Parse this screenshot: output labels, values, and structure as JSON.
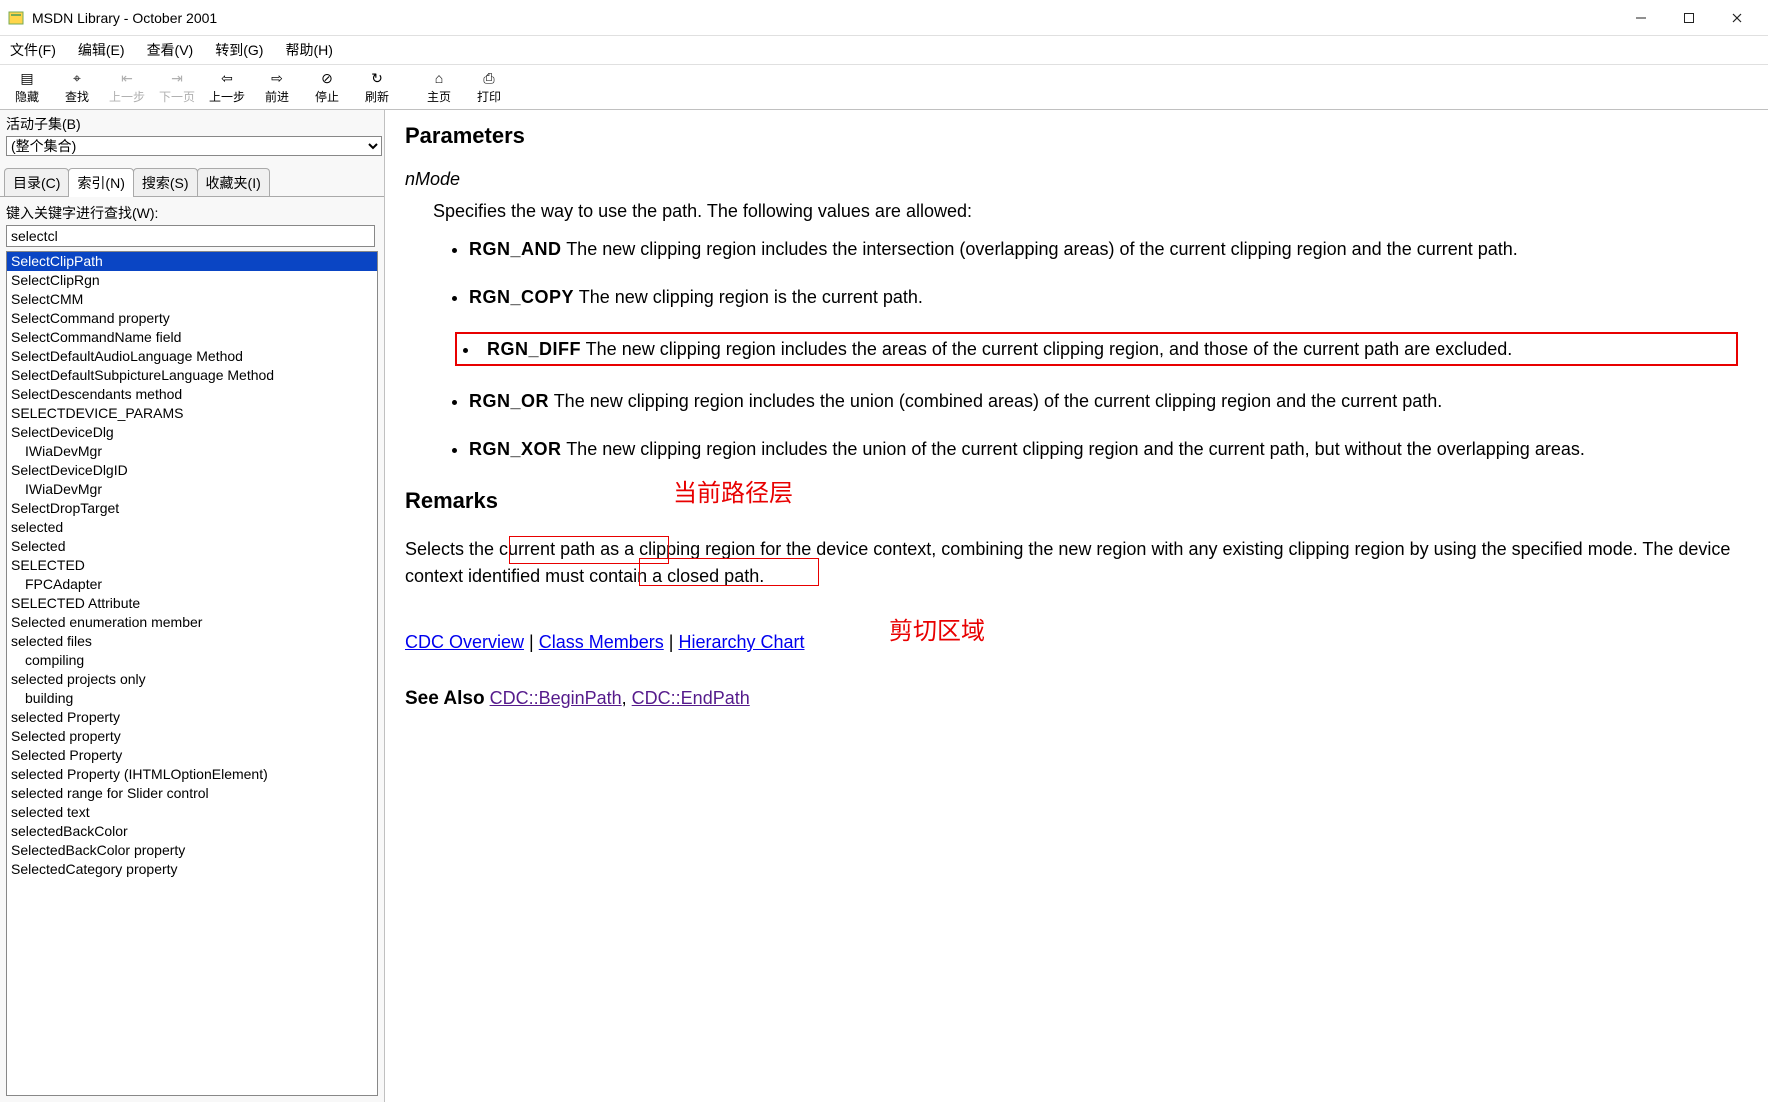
{
  "window": {
    "title": "MSDN Library - October 2001"
  },
  "menus": [
    "文件(F)",
    "编辑(E)",
    "查看(V)",
    "转到(G)",
    "帮助(H)"
  ],
  "toolbar": [
    {
      "icon": "hide-icon",
      "label": "隐藏",
      "enabled": true,
      "glyph": "▤"
    },
    {
      "icon": "locate-icon",
      "label": "查找",
      "enabled": true,
      "glyph": "⌖"
    },
    {
      "icon": "back-step-icon",
      "label": "上一步",
      "enabled": false,
      "glyph": "⇤"
    },
    {
      "icon": "next-page-icon",
      "label": "下一页",
      "enabled": false,
      "glyph": "⇥"
    },
    {
      "icon": "prev-icon",
      "label": "上一步",
      "enabled": true,
      "glyph": "⇦"
    },
    {
      "icon": "forward-icon",
      "label": "前进",
      "enabled": true,
      "glyph": "⇨"
    },
    {
      "icon": "stop-icon",
      "label": "停止",
      "enabled": true,
      "glyph": "⊘"
    },
    {
      "icon": "refresh-icon",
      "label": "刷新",
      "enabled": true,
      "glyph": "↻"
    },
    {
      "icon": "home-icon",
      "label": "主页",
      "enabled": true,
      "glyph": "⌂"
    },
    {
      "icon": "print-icon",
      "label": "打印",
      "enabled": true,
      "glyph": "⎙"
    }
  ],
  "sidebar": {
    "subset_label": "活动子集(B)",
    "subset_value": "(整个集合)",
    "tabs": [
      "目录(C)",
      "索引(N)",
      "搜索(S)",
      "收藏夹(I)"
    ],
    "active_tab_index": 1,
    "search_label": "键入关键字进行查找(W):",
    "search_value": "selectcl",
    "index_items": [
      {
        "text": "SelectClipPath",
        "selected": true
      },
      {
        "text": "SelectClipRgn"
      },
      {
        "text": "SelectCMM"
      },
      {
        "text": "SelectCommand property"
      },
      {
        "text": "SelectCommandName field"
      },
      {
        "text": "SelectDefaultAudioLanguage Method"
      },
      {
        "text": "SelectDefaultSubpictureLanguage Method"
      },
      {
        "text": "SelectDescendants method"
      },
      {
        "text": "SELECTDEVICE_PARAMS"
      },
      {
        "text": "SelectDeviceDlg"
      },
      {
        "text": "IWiaDevMgr",
        "indent": true
      },
      {
        "text": "SelectDeviceDlgID"
      },
      {
        "text": "IWiaDevMgr",
        "indent": true
      },
      {
        "text": "SelectDropTarget"
      },
      {
        "text": "selected"
      },
      {
        "text": "Selected"
      },
      {
        "text": "SELECTED"
      },
      {
        "text": "FPCAdapter",
        "indent": true
      },
      {
        "text": "SELECTED Attribute"
      },
      {
        "text": "Selected enumeration member"
      },
      {
        "text": "selected files"
      },
      {
        "text": "compiling",
        "indent": true
      },
      {
        "text": "selected projects only"
      },
      {
        "text": "building",
        "indent": true
      },
      {
        "text": "selected Property"
      },
      {
        "text": "Selected property"
      },
      {
        "text": "Selected Property"
      },
      {
        "text": "selected Property (IHTMLOptionElement)"
      },
      {
        "text": "selected range for Slider control"
      },
      {
        "text": "selected text"
      },
      {
        "text": "selectedBackColor"
      },
      {
        "text": "SelectedBackColor property"
      },
      {
        "text": "SelectedCategory property"
      }
    ]
  },
  "content": {
    "h_parameters": "Parameters",
    "param_name": "nMode",
    "param_intro": "Specifies the way to use the path. The following values are allowed:",
    "options": [
      {
        "const": "RGN_AND",
        "desc": "   The new clipping region includes the intersection (overlapping areas) of the current clipping region and the current path."
      },
      {
        "const": "RGN_COPY",
        "desc": "   The new clipping region is the current path."
      },
      {
        "const": "RGN_DIFF",
        "desc": "   The new clipping region includes the areas of the current clipping region, and those of the current path are excluded.",
        "highlight": true
      },
      {
        "const": "RGN_OR",
        "desc": "   The new clipping region includes the union (combined areas) of the current clipping region and the current path."
      },
      {
        "const": "RGN_XOR",
        "desc": "   The new clipping region includes the union of the current clipping region and the current path, but without the overlapping areas."
      }
    ],
    "h_remarks": "Remarks",
    "remarks_body": "Selects the current path as a clipping region for the device context, combining the new region with any existing clipping region by using the specified mode. The device context identified must contain a closed path.",
    "link_overview": "CDC Overview",
    "link_members": "Class Members",
    "link_hierarchy": "Hierarchy Chart",
    "sep_bar": " | ",
    "h_seealso": "See Also",
    "seealso_sep": "   ",
    "link_begin": "CDC::BeginPath",
    "link_end": "CDC::EndPath",
    "comma": ", ",
    "annot_path": "当前路径层",
    "annot_clip": "剪切区域"
  }
}
